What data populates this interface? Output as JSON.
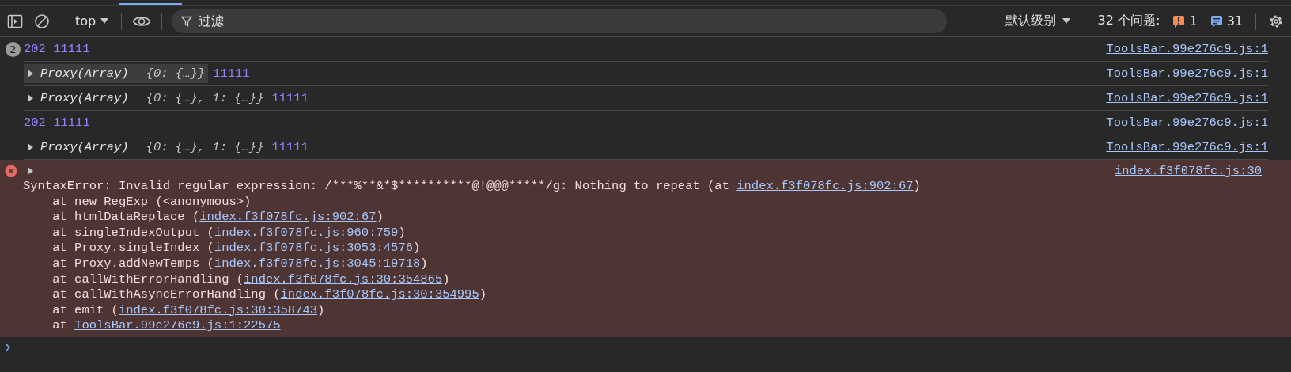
{
  "toolbar": {
    "context": "top",
    "filter": {
      "placeholder": "过滤"
    },
    "level": "默认级别",
    "issues": {
      "label": "32 个问题:",
      "counts": [
        {
          "kind": "warning",
          "count": "1"
        },
        {
          "kind": "info",
          "count": "31"
        }
      ]
    }
  },
  "messages": [
    {
      "kind": "log",
      "repeat": "2",
      "text": "202 11111",
      "source": "ToolsBar.99e276c9.js:1"
    },
    {
      "kind": "object",
      "name": "Proxy(Array)",
      "preview": "{0: {…}}",
      "value": "11111",
      "hovered": true,
      "source": "ToolsBar.99e276c9.js:1"
    },
    {
      "kind": "object",
      "name": "Proxy(Array)",
      "preview": "{0: {…}, 1: {…}}",
      "value": "11111",
      "hovered": false,
      "source": "ToolsBar.99e276c9.js:1"
    },
    {
      "kind": "log",
      "text": "202 11111",
      "source": "ToolsBar.99e276c9.js:1"
    },
    {
      "kind": "object",
      "name": "Proxy(Array)",
      "preview": "{0: {…}, 1: {…}}",
      "value": "11111",
      "hovered": false,
      "source": "ToolsBar.99e276c9.js:1"
    },
    {
      "kind": "error",
      "source": "index.f3f078fc.js:30",
      "lines": [
        {
          "text": "SyntaxError: Invalid regular expression: /***%**&*$**********@!@@@*****/g: Nothing to repeat (at ",
          "link": "index.f3f078fc.js:902:67",
          "after": ")"
        },
        {
          "text": "    at new RegExp (<anonymous>)"
        },
        {
          "text": "    at htmlDataReplace (",
          "link": "index.f3f078fc.js:902:67",
          "after": ")"
        },
        {
          "text": "    at singleIndexOutput (",
          "link": "index.f3f078fc.js:960:759",
          "after": ")"
        },
        {
          "text": "    at Proxy.singleIndex (",
          "link": "index.f3f078fc.js:3053:4576",
          "after": ")"
        },
        {
          "text": "    at Proxy.addNewTemps (",
          "link": "index.f3f078fc.js:3045:19718",
          "after": ")"
        },
        {
          "text": "    at callWithErrorHandling (",
          "link": "index.f3f078fc.js:30:354865",
          "after": ")"
        },
        {
          "text": "    at callWithAsyncErrorHandling (",
          "link": "index.f3f078fc.js:30:354995",
          "after": ")"
        },
        {
          "text": "    at emit (",
          "link": "index.f3f078fc.js:30:358743",
          "after": ")"
        },
        {
          "text": "    at ",
          "link": "ToolsBar.99e276c9.js:1:22575"
        }
      ]
    }
  ]
}
